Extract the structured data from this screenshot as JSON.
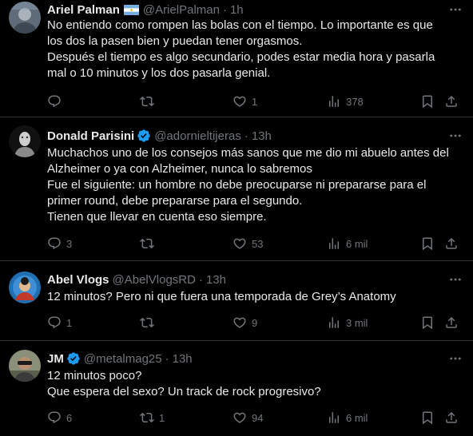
{
  "colors": {
    "background": "#000000",
    "text": "#e7e9ea",
    "secondary": "#71767b",
    "divider": "#2f3336",
    "verified": "#1d9bf0"
  },
  "tweets": [
    {
      "name": "Ariel Palman",
      "badge": "argentina-flag",
      "handle": "@ArielPalman",
      "time": "1h",
      "lines": [
        "No entiendo como rompen las bolas con el tiempo. Lo importante es que",
        "los dos la pasen bien y puedan tener orgasmos.",
        "Después el tiempo es algo secundario, podes estar media hora y pasarla",
        "mal o 10 minutos y los dos pasarla genial."
      ],
      "replies": "",
      "retweets": "",
      "likes": "1",
      "views": "378"
    },
    {
      "name": "Donald Parisini",
      "badge": "verified-badge",
      "handle": "@adornieltijeras",
      "time": "13h",
      "lines": [
        "Muchachos uno de los consejos más sanos que me dio mi abuelo antes del",
        "Alzheimer o ya con Alzheimer, nunca lo sabremos",
        "Fue el siguiente: un hombre no debe preocuparse ni prepararse para el",
        "primer round, debe prepararse para el segundo.",
        "Tienen que llevar en cuenta eso siempre."
      ],
      "replies": "3",
      "retweets": "",
      "likes": "53",
      "views": "6 mil"
    },
    {
      "name": "Abel Vlogs",
      "badge": "",
      "handle": "@AbelVlogsRD",
      "time": "13h",
      "lines": [
        "12 minutos? Pero ni que fuera una temporada de Grey’s Anatomy"
      ],
      "replies": "1",
      "retweets": "",
      "likes": "9",
      "views": "3 mil"
    },
    {
      "name": "JM",
      "badge": "verified-badge",
      "handle": "@metalmag25",
      "time": "13h",
      "lines": [
        "12 minutos poco?",
        "Que espera del sexo? Un track de rock progresivo?"
      ],
      "replies": "6",
      "retweets": "1",
      "likes": "94",
      "views": "6 mil"
    }
  ],
  "icons": {
    "reply": "reply-icon",
    "retweet": "retweet-icon",
    "like": "heart-icon",
    "views": "views-icon",
    "bookmark": "bookmark-icon",
    "share": "share-icon",
    "more": "more-icon"
  }
}
